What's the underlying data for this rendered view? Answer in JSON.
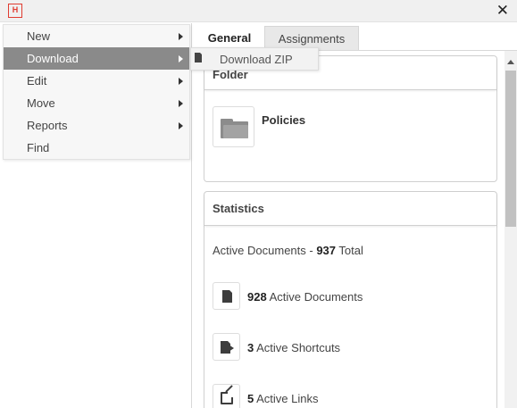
{
  "titlebar": {
    "logo_text": "H",
    "close_symbol": "✕"
  },
  "menu": {
    "items": [
      {
        "label": "New",
        "has_submenu": true,
        "active": false
      },
      {
        "label": "Download",
        "has_submenu": true,
        "active": true
      },
      {
        "label": "Edit",
        "has_submenu": true,
        "active": false
      },
      {
        "label": "Move",
        "has_submenu": true,
        "active": false
      },
      {
        "label": "Reports",
        "has_submenu": true,
        "active": false
      },
      {
        "label": "Find",
        "has_submenu": false,
        "active": false
      }
    ]
  },
  "submenu": {
    "items": [
      {
        "label": "Download ZIP",
        "icon": "file-zip-icon"
      }
    ]
  },
  "tabs": [
    {
      "label": "General",
      "selected": true
    },
    {
      "label": "Assignments",
      "selected": false
    }
  ],
  "folder_panel": {
    "title": "Folder",
    "folder_name": "Policies",
    "icon": "folder-icon"
  },
  "statistics": {
    "title": "Statistics",
    "total_prefix": "Active Documents - ",
    "total_count": "937",
    "total_suffix": " Total",
    "rows": [
      {
        "count": "928",
        "label": " Active Documents",
        "icon": "document-icon"
      },
      {
        "count": "3",
        "label": " Active Shortcuts",
        "icon": "shortcut-icon"
      },
      {
        "count": "5",
        "label": " Active Links",
        "icon": "external-link-icon"
      }
    ]
  },
  "colors": {
    "brand": "#e03c31",
    "menu_active": "#8a8a8a"
  }
}
